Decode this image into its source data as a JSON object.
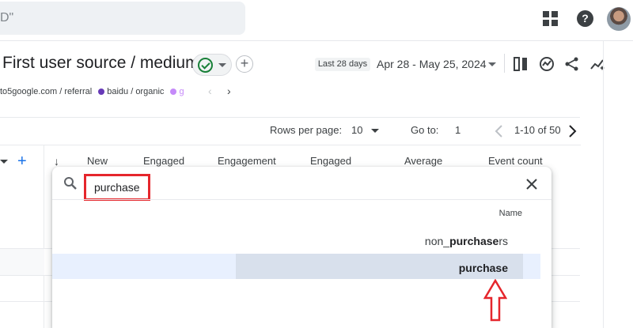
{
  "header": {
    "search_text": "D\"",
    "icons": [
      "apps-icon",
      "help-icon",
      "avatar"
    ]
  },
  "report": {
    "title": "First user source / medium",
    "add_symbol": "+",
    "date_badge": "Last 28 days",
    "date_range": "Apr 28 - May 25, 2024",
    "legend": [
      {
        "label": "to5google.com / referral",
        "color": ""
      },
      {
        "label": "baidu / organic",
        "color": "#673ab7"
      },
      {
        "label": "g",
        "color": "#c58af9"
      }
    ],
    "legend_chevrons": [
      "‹",
      "›"
    ]
  },
  "pager": {
    "rows_per_page_label": "Rows per page:",
    "rows_per_page_value": "10",
    "goto_label": "Go to:",
    "goto_value": "1",
    "range": "1-10 of 50"
  },
  "table": {
    "sort_arrow": "↓",
    "plus": "+",
    "columns": [
      "New",
      "Engaged",
      "Engagement",
      "Engaged",
      "Average",
      "Event count"
    ]
  },
  "popup": {
    "search_value": "purchase",
    "column_header": "Name",
    "options": [
      {
        "prefix": "non_",
        "match": "purchase",
        "suffix": "rs"
      },
      {
        "prefix": "",
        "match": "purchase",
        "suffix": ""
      }
    ]
  },
  "colors": {
    "annotation_red": "#e5262c",
    "highlight": "#e8f0fe",
    "status_green": "#188038"
  }
}
